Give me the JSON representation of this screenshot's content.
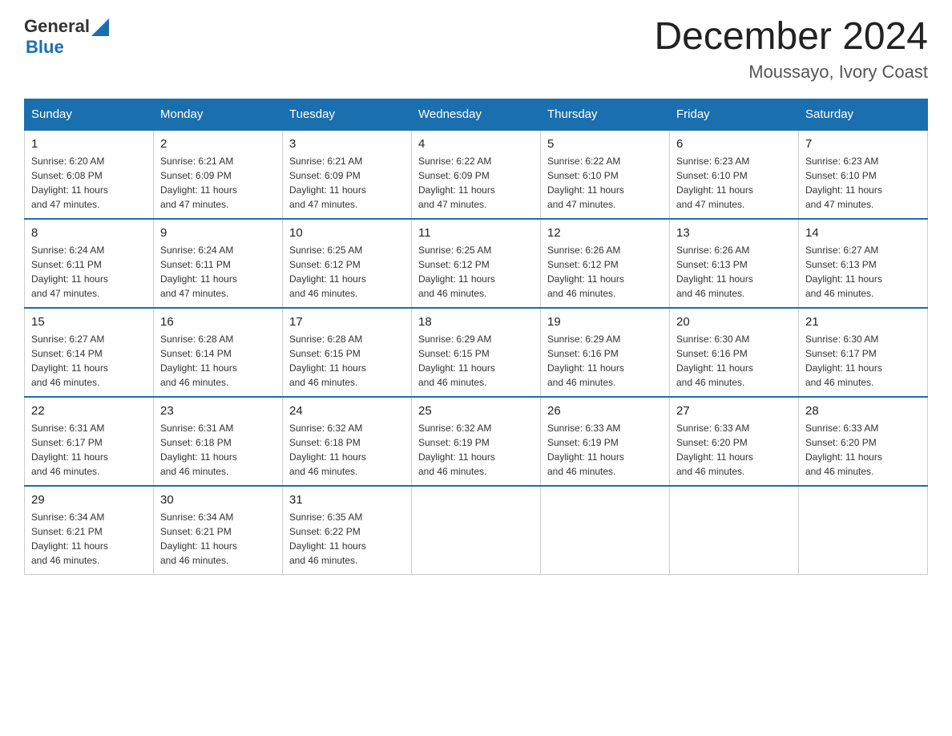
{
  "header": {
    "logo": {
      "text_general": "General",
      "text_blue": "Blue"
    },
    "title": "December 2024",
    "location": "Moussayo, Ivory Coast"
  },
  "days_of_week": [
    "Sunday",
    "Monday",
    "Tuesday",
    "Wednesday",
    "Thursday",
    "Friday",
    "Saturday"
  ],
  "weeks": [
    [
      {
        "day": "1",
        "sunrise": "6:20 AM",
        "sunset": "6:08 PM",
        "daylight": "11 hours and 47 minutes."
      },
      {
        "day": "2",
        "sunrise": "6:21 AM",
        "sunset": "6:09 PM",
        "daylight": "11 hours and 47 minutes."
      },
      {
        "day": "3",
        "sunrise": "6:21 AM",
        "sunset": "6:09 PM",
        "daylight": "11 hours and 47 minutes."
      },
      {
        "day": "4",
        "sunrise": "6:22 AM",
        "sunset": "6:09 PM",
        "daylight": "11 hours and 47 minutes."
      },
      {
        "day": "5",
        "sunrise": "6:22 AM",
        "sunset": "6:10 PM",
        "daylight": "11 hours and 47 minutes."
      },
      {
        "day": "6",
        "sunrise": "6:23 AM",
        "sunset": "6:10 PM",
        "daylight": "11 hours and 47 minutes."
      },
      {
        "day": "7",
        "sunrise": "6:23 AM",
        "sunset": "6:10 PM",
        "daylight": "11 hours and 47 minutes."
      }
    ],
    [
      {
        "day": "8",
        "sunrise": "6:24 AM",
        "sunset": "6:11 PM",
        "daylight": "11 hours and 47 minutes."
      },
      {
        "day": "9",
        "sunrise": "6:24 AM",
        "sunset": "6:11 PM",
        "daylight": "11 hours and 47 minutes."
      },
      {
        "day": "10",
        "sunrise": "6:25 AM",
        "sunset": "6:12 PM",
        "daylight": "11 hours and 46 minutes."
      },
      {
        "day": "11",
        "sunrise": "6:25 AM",
        "sunset": "6:12 PM",
        "daylight": "11 hours and 46 minutes."
      },
      {
        "day": "12",
        "sunrise": "6:26 AM",
        "sunset": "6:12 PM",
        "daylight": "11 hours and 46 minutes."
      },
      {
        "day": "13",
        "sunrise": "6:26 AM",
        "sunset": "6:13 PM",
        "daylight": "11 hours and 46 minutes."
      },
      {
        "day": "14",
        "sunrise": "6:27 AM",
        "sunset": "6:13 PM",
        "daylight": "11 hours and 46 minutes."
      }
    ],
    [
      {
        "day": "15",
        "sunrise": "6:27 AM",
        "sunset": "6:14 PM",
        "daylight": "11 hours and 46 minutes."
      },
      {
        "day": "16",
        "sunrise": "6:28 AM",
        "sunset": "6:14 PM",
        "daylight": "11 hours and 46 minutes."
      },
      {
        "day": "17",
        "sunrise": "6:28 AM",
        "sunset": "6:15 PM",
        "daylight": "11 hours and 46 minutes."
      },
      {
        "day": "18",
        "sunrise": "6:29 AM",
        "sunset": "6:15 PM",
        "daylight": "11 hours and 46 minutes."
      },
      {
        "day": "19",
        "sunrise": "6:29 AM",
        "sunset": "6:16 PM",
        "daylight": "11 hours and 46 minutes."
      },
      {
        "day": "20",
        "sunrise": "6:30 AM",
        "sunset": "6:16 PM",
        "daylight": "11 hours and 46 minutes."
      },
      {
        "day": "21",
        "sunrise": "6:30 AM",
        "sunset": "6:17 PM",
        "daylight": "11 hours and 46 minutes."
      }
    ],
    [
      {
        "day": "22",
        "sunrise": "6:31 AM",
        "sunset": "6:17 PM",
        "daylight": "11 hours and 46 minutes."
      },
      {
        "day": "23",
        "sunrise": "6:31 AM",
        "sunset": "6:18 PM",
        "daylight": "11 hours and 46 minutes."
      },
      {
        "day": "24",
        "sunrise": "6:32 AM",
        "sunset": "6:18 PM",
        "daylight": "11 hours and 46 minutes."
      },
      {
        "day": "25",
        "sunrise": "6:32 AM",
        "sunset": "6:19 PM",
        "daylight": "11 hours and 46 minutes."
      },
      {
        "day": "26",
        "sunrise": "6:33 AM",
        "sunset": "6:19 PM",
        "daylight": "11 hours and 46 minutes."
      },
      {
        "day": "27",
        "sunrise": "6:33 AM",
        "sunset": "6:20 PM",
        "daylight": "11 hours and 46 minutes."
      },
      {
        "day": "28",
        "sunrise": "6:33 AM",
        "sunset": "6:20 PM",
        "daylight": "11 hours and 46 minutes."
      }
    ],
    [
      {
        "day": "29",
        "sunrise": "6:34 AM",
        "sunset": "6:21 PM",
        "daylight": "11 hours and 46 minutes."
      },
      {
        "day": "30",
        "sunrise": "6:34 AM",
        "sunset": "6:21 PM",
        "daylight": "11 hours and 46 minutes."
      },
      {
        "day": "31",
        "sunrise": "6:35 AM",
        "sunset": "6:22 PM",
        "daylight": "11 hours and 46 minutes."
      },
      null,
      null,
      null,
      null
    ]
  ],
  "labels": {
    "sunrise": "Sunrise:",
    "sunset": "Sunset:",
    "daylight": "Daylight:"
  }
}
